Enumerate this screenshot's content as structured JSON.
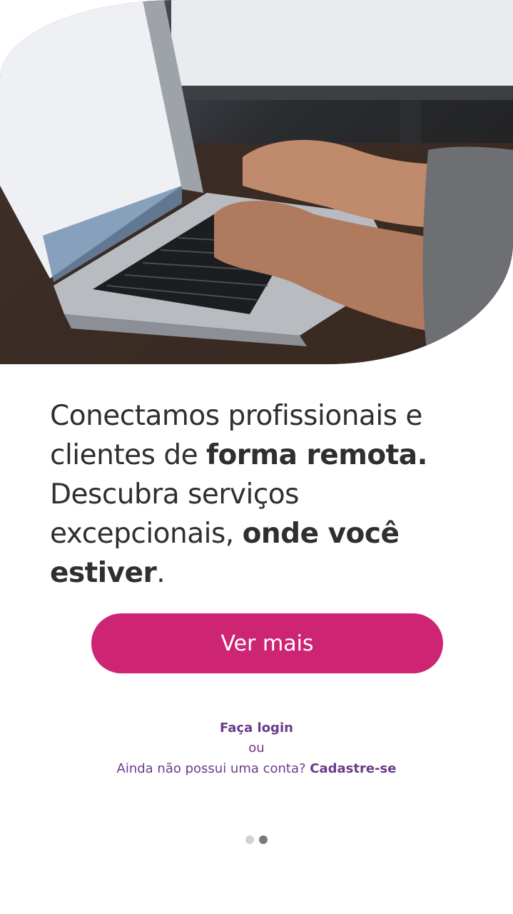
{
  "hero": {
    "image_description_icon": "laptop-typing-photo"
  },
  "headline": {
    "part1": "Conectamos profissionais e clientes de ",
    "bold1": "forma remota.",
    "part2": " Descubra serviços excepcionais, ",
    "bold2": "onde você estiver",
    "end": "."
  },
  "cta": {
    "label": "Ver mais"
  },
  "auth": {
    "login_label": "Faça login",
    "or_label": "ou",
    "signup_prompt": "Ainda não possui uma conta? ",
    "signup_label": "Cadastre-se"
  },
  "pager": {
    "total": 2,
    "active": 2
  },
  "colors": {
    "primary": "#cd2473",
    "link": "#6b3a8b",
    "text": "#2f2f2f"
  }
}
